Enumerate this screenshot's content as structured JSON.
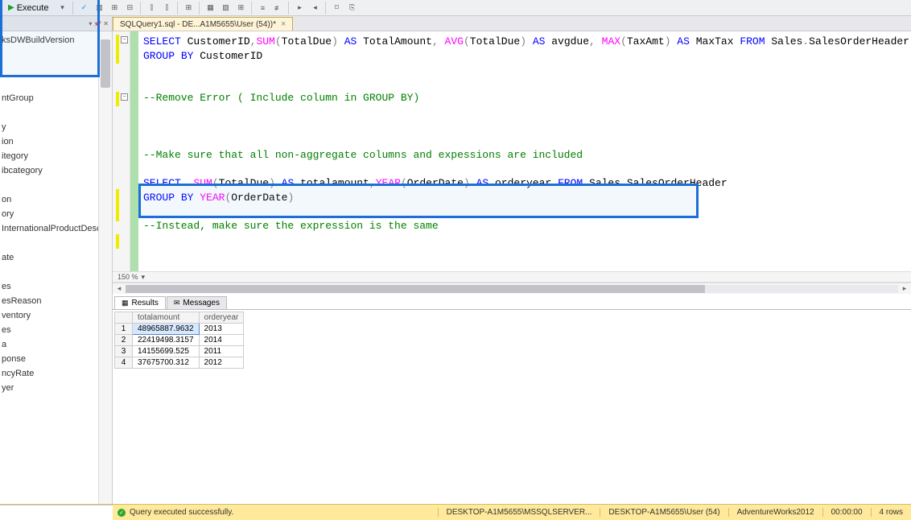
{
  "toolbar": {
    "execute_label": "Execute"
  },
  "tab": {
    "title": "SQLQuery1.sql - DE...A1M5655\\User (54))*"
  },
  "tree": {
    "items": [
      "ksDWBuildVersion",
      "",
      "",
      "",
      "ntGroup",
      "",
      "y",
      "ion",
      "itegory",
      "ibcategory",
      "",
      "on",
      "ory",
      "InternationalProductDescription",
      "",
      "ate",
      "",
      "es",
      "esReason",
      "ventory",
      "es",
      "a",
      "ponse",
      "ncyRate",
      "yer"
    ]
  },
  "code": {
    "l1a": "SELECT",
    "l1b": " CustomerID",
    "l1c": ",",
    "l1d": "SUM",
    "l1e": "(",
    "l1f": "TotalDue",
    "l1g": ")",
    "l1h": " AS",
    "l1i": " TotalAmount",
    "l1j": ",",
    "l1k": " AVG",
    "l1l": "(",
    "l1m": "TotalDue",
    "l1n": ")",
    "l1o": " AS",
    "l1p": " avgdue",
    "l1q": ",",
    "l1r": " MAX",
    "l1s": "(",
    "l1t": "TaxAmt",
    "l1u": ")",
    "l1v": " AS",
    "l1w": " MaxTax",
    "l1x": " FROM",
    "l1y": " Sales",
    "l1z": ".",
    "l1aa": "SalesOrderHeader",
    "l2a": "GROUP",
    "l2b": " BY",
    "l2c": " CustomerID",
    "l5": "--Remove Error ( Include column in GROUP BY)",
    "l9": "--Make sure that all non-aggregate columns and expessions are included",
    "l11a": "SELECT",
    "l11b": "  SUM",
    "l11c": "(",
    "l11d": "TotalDue",
    "l11e": ")",
    "l11f": " AS",
    "l11g": " totalamount",
    "l11h": ",",
    "l11i": "YEAR",
    "l11j": "(",
    "l11k": "OrderDate",
    "l11l": ")",
    "l11m": " AS",
    "l11n": " orderyear",
    "l11o": " FROM",
    "l11p": " Sales",
    "l11q": ".",
    "l11r": "SalesOrderHeader",
    "l12a": "GROUP",
    "l12b": " BY",
    "l12c": " YEAR",
    "l12d": "(",
    "l12e": "OrderDate",
    "l12f": ")",
    "l14": "--Instead, make sure the expression is the same"
  },
  "zoom": "150 %",
  "results": {
    "tab_results": "Results",
    "tab_messages": "Messages",
    "columns": [
      "",
      "totalamount",
      "orderyear"
    ],
    "rows": [
      {
        "n": "1",
        "totalamount": "48965887.9632",
        "orderyear": "2013"
      },
      {
        "n": "2",
        "totalamount": "22419498.3157",
        "orderyear": "2014"
      },
      {
        "n": "3",
        "totalamount": "14155699.525",
        "orderyear": "2011"
      },
      {
        "n": "4",
        "totalamount": "37675700.312",
        "orderyear": "2012"
      }
    ]
  },
  "status": {
    "msg": "Query executed successfully.",
    "server": "DESKTOP-A1M5655\\MSSQLSERVER...",
    "user": "DESKTOP-A1M5655\\User (54)",
    "db": "AdventureWorks2012",
    "time": "00:00:00",
    "rows": "4 rows"
  }
}
